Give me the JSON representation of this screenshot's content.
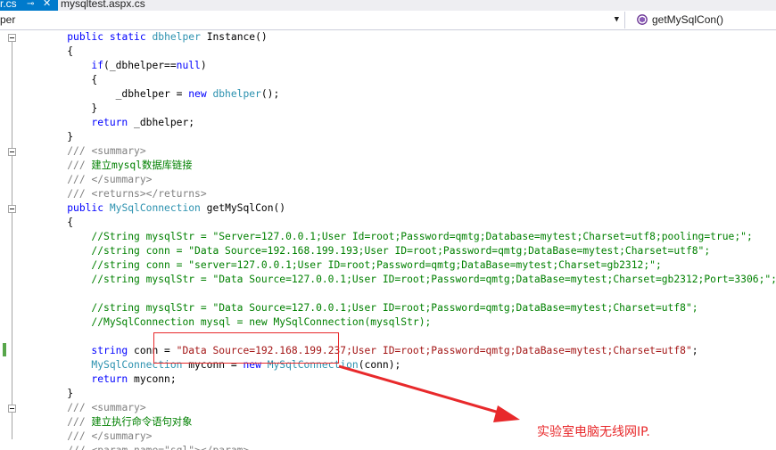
{
  "tabs": {
    "active": {
      "label": "r.cs",
      "pin_glyph": "⊸",
      "close_glyph": "✕"
    },
    "inactive": {
      "label": "mysqltest.aspx.cs"
    }
  },
  "navbar": {
    "left_value": "per",
    "right_value": "getMySqlCon()"
  },
  "code_lines": [
    [
      {
        "t": "    "
      },
      {
        "k": "public"
      },
      {
        "t": " "
      },
      {
        "k": "static"
      },
      {
        "t": " "
      },
      {
        "y": "dbhelper"
      },
      {
        "t": " Instance()"
      }
    ],
    [
      {
        "t": "    {"
      }
    ],
    [
      {
        "t": "        "
      },
      {
        "k": "if"
      },
      {
        "t": "(_dbhelper=="
      },
      {
        "k": "null"
      },
      {
        "t": ")"
      }
    ],
    [
      {
        "t": "        {"
      }
    ],
    [
      {
        "t": "            _dbhelper = "
      },
      {
        "k": "new"
      },
      {
        "t": " "
      },
      {
        "y": "dbhelper"
      },
      {
        "t": "();"
      }
    ],
    [
      {
        "t": "        }"
      }
    ],
    [
      {
        "t": "        "
      },
      {
        "k": "return"
      },
      {
        "t": " _dbhelper;"
      }
    ],
    [
      {
        "t": "    }"
      }
    ],
    [
      {
        "t": "    "
      },
      {
        "x": "///"
      },
      {
        "c": " "
      },
      {
        "x": "<summary>"
      }
    ],
    [
      {
        "t": "    "
      },
      {
        "x": "///"
      },
      {
        "c": " 建立mysql数据库链接"
      }
    ],
    [
      {
        "t": "    "
      },
      {
        "x": "///"
      },
      {
        "c": " "
      },
      {
        "x": "</summary>"
      }
    ],
    [
      {
        "t": "    "
      },
      {
        "x": "///"
      },
      {
        "c": " "
      },
      {
        "x": "<returns></returns>"
      }
    ],
    [
      {
        "t": "    "
      },
      {
        "k": "public"
      },
      {
        "t": " "
      },
      {
        "y": "MySqlConnection"
      },
      {
        "t": " getMySqlCon()"
      }
    ],
    [
      {
        "t": "    {"
      }
    ],
    [
      {
        "t": "        "
      },
      {
        "c": "//String mysqlStr = \"Server=127.0.0.1;User Id=root;Password=qmtg;Database=mytest;Charset=utf8;pooling=true;\";"
      }
    ],
    [
      {
        "t": "        "
      },
      {
        "c": "//string conn = \"Data Source=192.168.199.193;User ID=root;Password=qmtg;DataBase=mytest;Charset=utf8\";"
      }
    ],
    [
      {
        "t": "        "
      },
      {
        "c": "//string conn = \"server=127.0.0.1;User ID=root;Password=qmtg;DataBase=mytest;Charset=gb2312;\";"
      }
    ],
    [
      {
        "t": "        "
      },
      {
        "c": "//string mysqlStr = \"Data Source=127.0.0.1;User ID=root;Password=qmtg;DataBase=mytest;Charset=gb2312;Port=3306;\";"
      }
    ],
    [],
    [
      {
        "t": "        "
      },
      {
        "c": "//string mysqlStr = \"Data Source=127.0.0.1;User ID=root;Password=qmtg;DataBase=mytest;Charset=utf8\";"
      }
    ],
    [
      {
        "t": "        "
      },
      {
        "c": "//MySqlConnection mysql = new MySqlConnection(mysqlStr);"
      }
    ],
    [],
    [
      {
        "t": "        "
      },
      {
        "k": "string"
      },
      {
        "t": " conn = "
      },
      {
        "s": "\"Data Source=192.168.199.237;User ID=root;Password=qmtg;DataBase=mytest;Charset=utf8\""
      },
      {
        "t": ";"
      }
    ],
    [
      {
        "t": "        "
      },
      {
        "y": "MySqlConnection"
      },
      {
        "t": " myconn = "
      },
      {
        "k": "new"
      },
      {
        "t": " "
      },
      {
        "y": "MySqlConnection"
      },
      {
        "t": "(conn);"
      }
    ],
    [
      {
        "t": "        "
      },
      {
        "k": "return"
      },
      {
        "t": " myconn;"
      }
    ],
    [
      {
        "t": "    }"
      }
    ],
    [
      {
        "t": "    "
      },
      {
        "x": "///"
      },
      {
        "c": " "
      },
      {
        "x": "<summary>"
      }
    ],
    [
      {
        "t": "    "
      },
      {
        "x": "///"
      },
      {
        "c": " 建立执行命令语句对象"
      }
    ],
    [
      {
        "t": "    "
      },
      {
        "x": "///"
      },
      {
        "c": " "
      },
      {
        "x": "</summary>"
      }
    ],
    [
      {
        "t": "    "
      },
      {
        "x": "///"
      },
      {
        "c": " "
      },
      {
        "x": "<param name=\"sql\"></param>"
      }
    ]
  ],
  "annotation": {
    "text": "实验室电脑无线网IP.",
    "color": "#e8292b"
  },
  "colors": {
    "tab_active": "#007acc",
    "keyword": "#0000ff",
    "type": "#2b91af",
    "comment": "#008000",
    "string": "#a31515",
    "xml_doc": "#808080",
    "change_bar": "#57a64a"
  },
  "icons": {
    "method": "purple-cube-icon",
    "fold": "collapse-box-icon"
  }
}
